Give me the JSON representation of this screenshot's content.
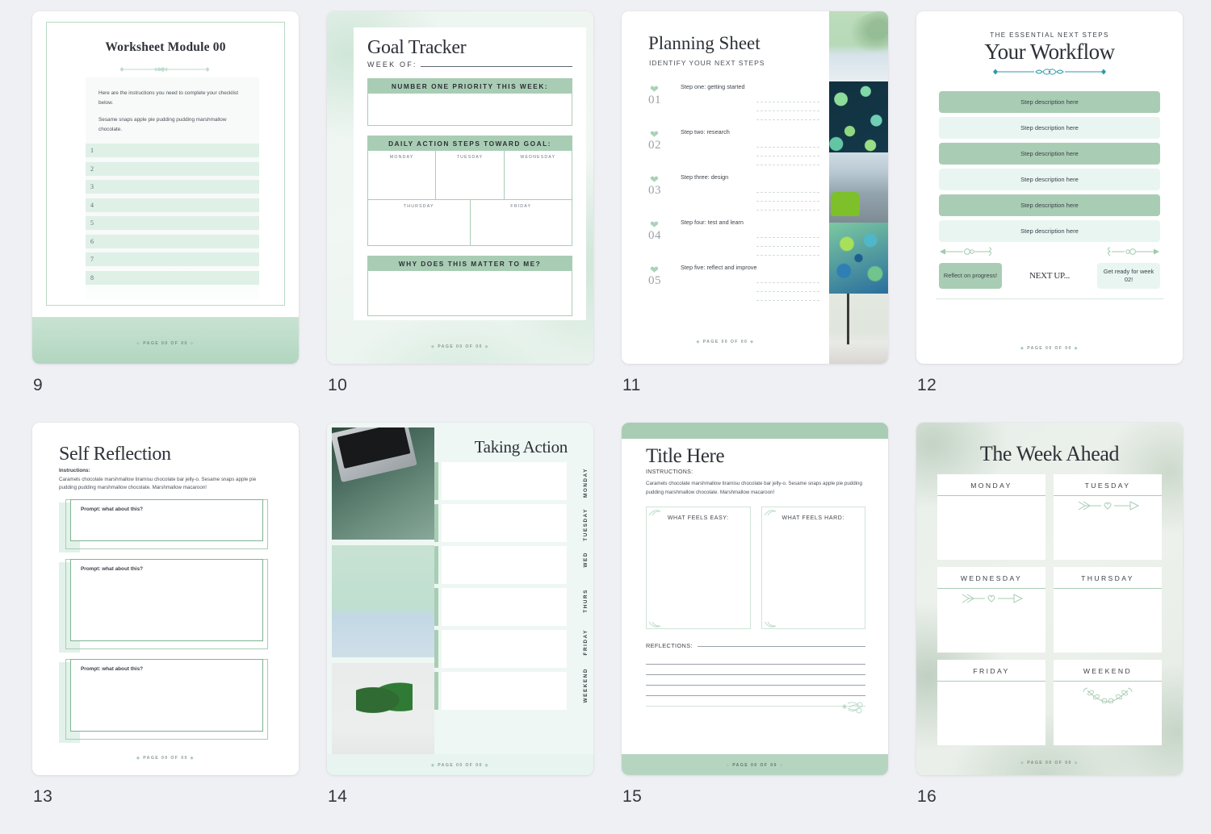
{
  "theme": {
    "background": "#eff0f4",
    "green_dark": "#a9cdb4",
    "green_light": "#e9f5f1",
    "green_row": "#dff0e7",
    "teal_accent": "#2f9aa8",
    "ink": "#2e3138"
  },
  "footer_note": "PAGE 00 OF 00",
  "pages": [
    {
      "number": "9",
      "name": "worksheet-module",
      "title": "Worksheet Module 00",
      "instructions": [
        "Here are the instructions you need to complete your checklist below.",
        "Sesame snaps apple pie pudding pudding marshmallow chocolate."
      ],
      "checklist": [
        "1",
        "2",
        "3",
        "4",
        "5",
        "6",
        "7",
        "8"
      ]
    },
    {
      "number": "10",
      "name": "goal-tracker",
      "title": "Goal Tracker",
      "week_of_label": "WEEK OF:",
      "priority_header": "NUMBER ONE PRIORITY THIS WEEK:",
      "daily_header": "DAILY ACTION STEPS TOWARD GOAL:",
      "days_row1": [
        "MONDAY",
        "TUESDAY",
        "WEDNESDAY"
      ],
      "days_row2": [
        "THURSDAY",
        "FRIDAY"
      ],
      "why_header": "WHY DOES THIS MATTER TO ME?"
    },
    {
      "number": "11",
      "name": "planning-sheet",
      "title": "Planning Sheet",
      "subtitle": "IDENTIFY YOUR NEXT STEPS",
      "steps": [
        {
          "num": "01",
          "label": "Step one: getting started"
        },
        {
          "num": "02",
          "label": "Step two: research"
        },
        {
          "num": "03",
          "label": "Step three: design"
        },
        {
          "num": "04",
          "label": "Step four: test and learn"
        },
        {
          "num": "05",
          "label": "Step five: reflect and improve"
        }
      ],
      "photo_names": [
        "palm-shadow-photo",
        "tropical-leaves-pattern",
        "green-office-chair-photo",
        "painted-tree-artwork",
        "window-desk-photo"
      ]
    },
    {
      "number": "12",
      "name": "your-workflow",
      "kicker": "THE ESSENTIAL NEXT STEPS",
      "title": "Your Workflow",
      "steps": [
        "Step description here",
        "Step description here",
        "Step description here",
        "Step description here",
        "Step description here",
        "Step description here"
      ],
      "left_pill": "Reflect on progress!",
      "center_label": "NEXT UP...",
      "right_pill": "Get ready for week 02!"
    },
    {
      "number": "13",
      "name": "self-reflection",
      "title": "Self Reflection",
      "instructions_header": "Instructions:",
      "instructions_body": "Caramels chocolate marshmallow tiramisu chocolate bar jelly-o. Sesame snaps apple pie pudding pudding marshmallow chocolate. Marshmallow macaroon!",
      "prompts": [
        "Prompt: what about this?",
        "Prompt: what about this?",
        "Prompt: what about this?"
      ]
    },
    {
      "number": "14",
      "name": "taking-action",
      "title": "Taking Action",
      "photo_names": [
        "laptop-on-green-fabric-photo",
        "palm-shadow-gradient-photo",
        "plant-in-vase-photo"
      ],
      "days": [
        "MONDAY",
        "TUESDAY",
        "WED",
        "THURS",
        "FRIDAY",
        "WEEKEND"
      ]
    },
    {
      "number": "15",
      "name": "title-here",
      "title": "Title Here",
      "instructions_header": "INSTRUCTIONS:",
      "instructions_body": "Caramels chocolate marshmallow tiramisu chocolate bar jelly-o. Sesame snaps apple pie pudding pudding marshmallow chocolate. Marshmallow macaroon!",
      "columns": [
        "WHAT FEELS EASY:",
        "WHAT FEELS HARD:"
      ],
      "reflections_label": "REFLECTIONS:"
    },
    {
      "number": "16",
      "name": "the-week-ahead",
      "title": "The Week Ahead",
      "days": [
        {
          "label": "MONDAY",
          "ornament": ""
        },
        {
          "label": "TUESDAY",
          "ornament": "arrow-heart-ornament"
        },
        {
          "label": "WEDNESDAY",
          "ornament": "arrow-heart-ornament"
        },
        {
          "label": "THURSDAY",
          "ornament": ""
        },
        {
          "label": "FRIDAY",
          "ornament": ""
        },
        {
          "label": "WEEKEND",
          "ornament": "floral-branch-ornament"
        }
      ]
    }
  ]
}
